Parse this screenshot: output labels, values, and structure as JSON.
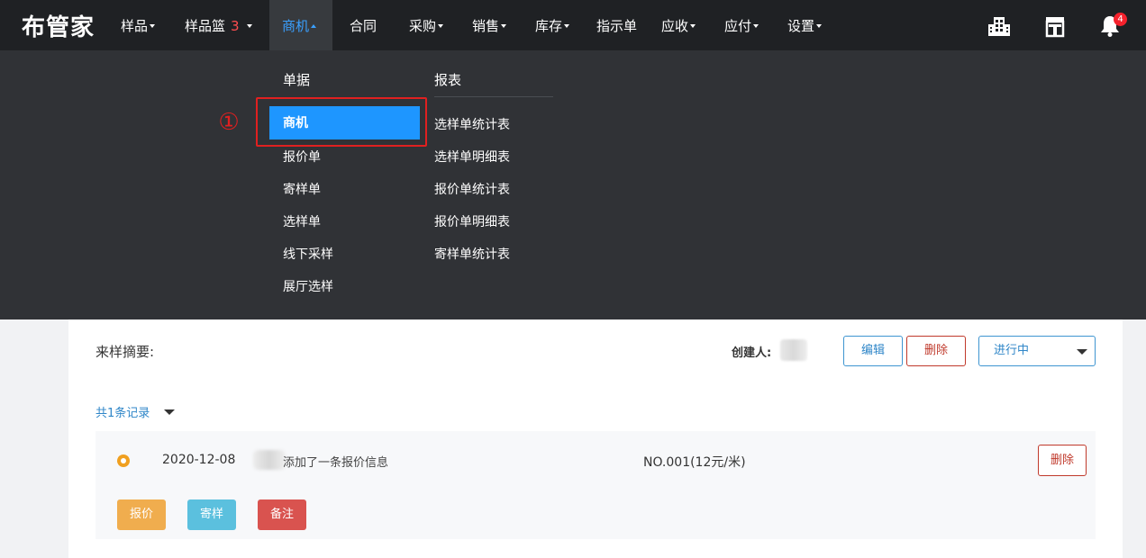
{
  "app": {
    "logo": "布管家"
  },
  "nav": {
    "items": [
      {
        "label": "样品"
      },
      {
        "label": "样品篮",
        "count": "3"
      },
      {
        "label": "商机"
      },
      {
        "label": "合同"
      },
      {
        "label": "采购"
      },
      {
        "label": "销售"
      },
      {
        "label": "库存"
      },
      {
        "label": "指示单"
      },
      {
        "label": "应收"
      },
      {
        "label": "应付"
      },
      {
        "label": "设置"
      }
    ],
    "notification_count": "4",
    "icons": [
      "building-icon",
      "store-icon",
      "bell-icon"
    ]
  },
  "dropdown": {
    "documents_title": "单据",
    "reports_title": "报表",
    "documents": [
      "商机",
      "报价单",
      "寄样单",
      "选样单",
      "线下采样",
      "展厅选样"
    ],
    "reports": [
      "选样单统计表",
      "选样单明细表",
      "报价单统计表",
      "报价单明细表",
      "寄样单统计表"
    ],
    "step_marker": "①"
  },
  "detail": {
    "summary_label": "来样摘要:",
    "creator_label": "创建人:",
    "edit_label": "编辑",
    "delete_label": "删除",
    "status_value": "进行中",
    "records_label": "共1条记录"
  },
  "record": {
    "date": "2020-12-08",
    "text": "添加了一条报价信息",
    "number": "NO.001(12元/米)",
    "delete_label": "删除",
    "actions": [
      "报价",
      "寄样",
      "备注"
    ]
  },
  "colors": {
    "nav_bg": "#1f2124",
    "dropdown_bg": "#303236",
    "accent": "#1e96ff",
    "highlight": "#e02020"
  }
}
